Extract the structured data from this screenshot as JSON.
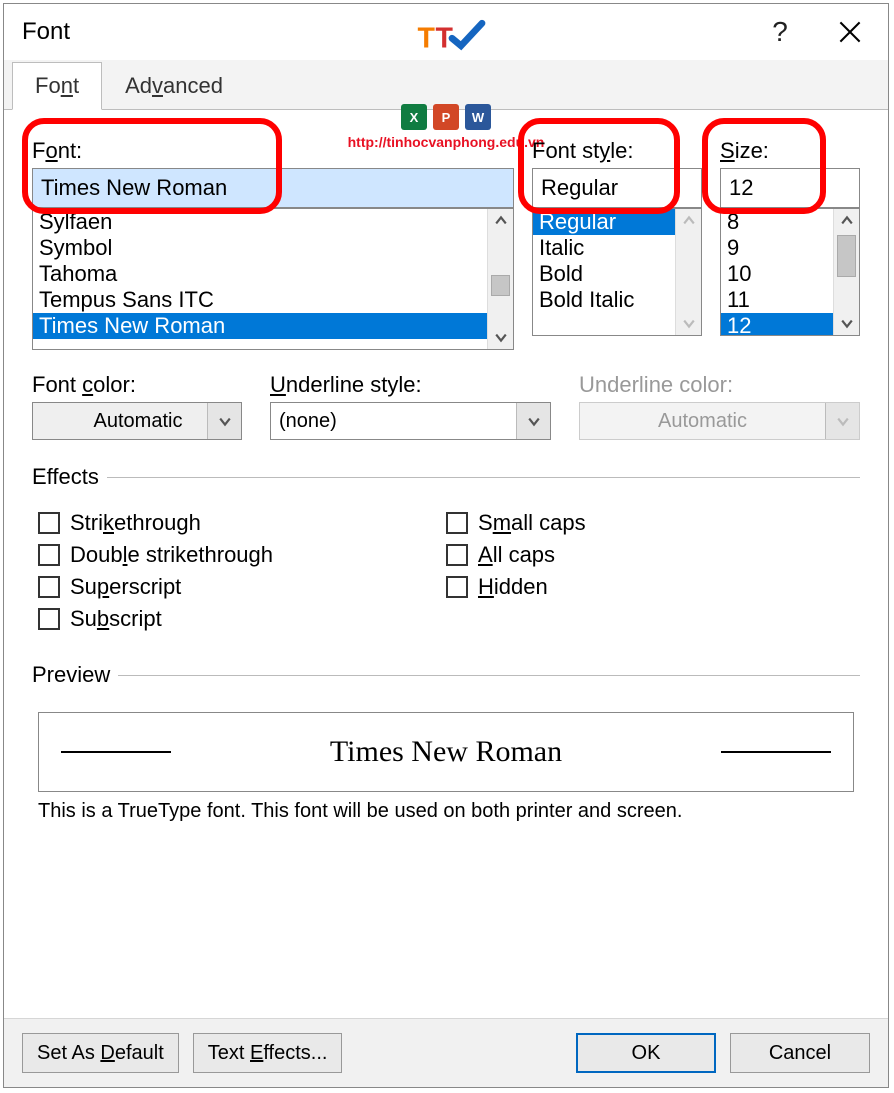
{
  "dialog": {
    "title": "Font"
  },
  "watermark": {
    "url": "http://tinhocvanphong.edu.vn"
  },
  "tabs": {
    "font": "Font",
    "advanced": "Advanced"
  },
  "font": {
    "label_pre": "F",
    "label_u": "o",
    "label_post": "nt:",
    "value": "Times New Roman",
    "items": [
      "Sylfaen",
      "Symbol",
      "Tahoma",
      "Tempus Sans ITC",
      "Times New Roman"
    ]
  },
  "style": {
    "label_pre": "Font st",
    "label_u": "y",
    "label_post": "le:",
    "value": "Regular",
    "items": [
      "Regular",
      "Italic",
      "Bold",
      "Bold Italic"
    ]
  },
  "size": {
    "label_u": "S",
    "label_post": "ize:",
    "value": "12",
    "items": [
      "8",
      "9",
      "10",
      "11",
      "12"
    ]
  },
  "fontcolor": {
    "label_pre": "Font ",
    "label_u": "c",
    "label_post": "olor:",
    "value": "Automatic"
  },
  "ulstyle": {
    "label_u": "U",
    "label_post": "nderline style:",
    "value": "(none)"
  },
  "ulcolor": {
    "label": "Underline color:",
    "value": "Automatic"
  },
  "effects": {
    "legend": "Effects",
    "strike_u": "k",
    "strike_pre": "Stri",
    "strike_post": "ethrough",
    "dstrike_pre": "Doub",
    "dstrike_u": "l",
    "dstrike_post": "e strikethrough",
    "super_pre": "Su",
    "super_u": "p",
    "super_post": "erscript",
    "sub_pre": "Su",
    "sub_u": "b",
    "sub_post": "script",
    "small_pre": "S",
    "small_u": "m",
    "small_post": "all caps",
    "all_u": "A",
    "all_post": "ll caps",
    "hidden_u": "H",
    "hidden_post": "idden"
  },
  "preview": {
    "legend": "Preview",
    "sample": "Times New Roman",
    "desc": "This is a TrueType font. This font will be used on both printer and screen."
  },
  "footer": {
    "default_pre": "Set As ",
    "default_u": "D",
    "default_post": "efault",
    "effects_pre": "Text ",
    "effects_u": "E",
    "effects_post": "ffects...",
    "ok": "OK",
    "cancel": "Cancel"
  }
}
